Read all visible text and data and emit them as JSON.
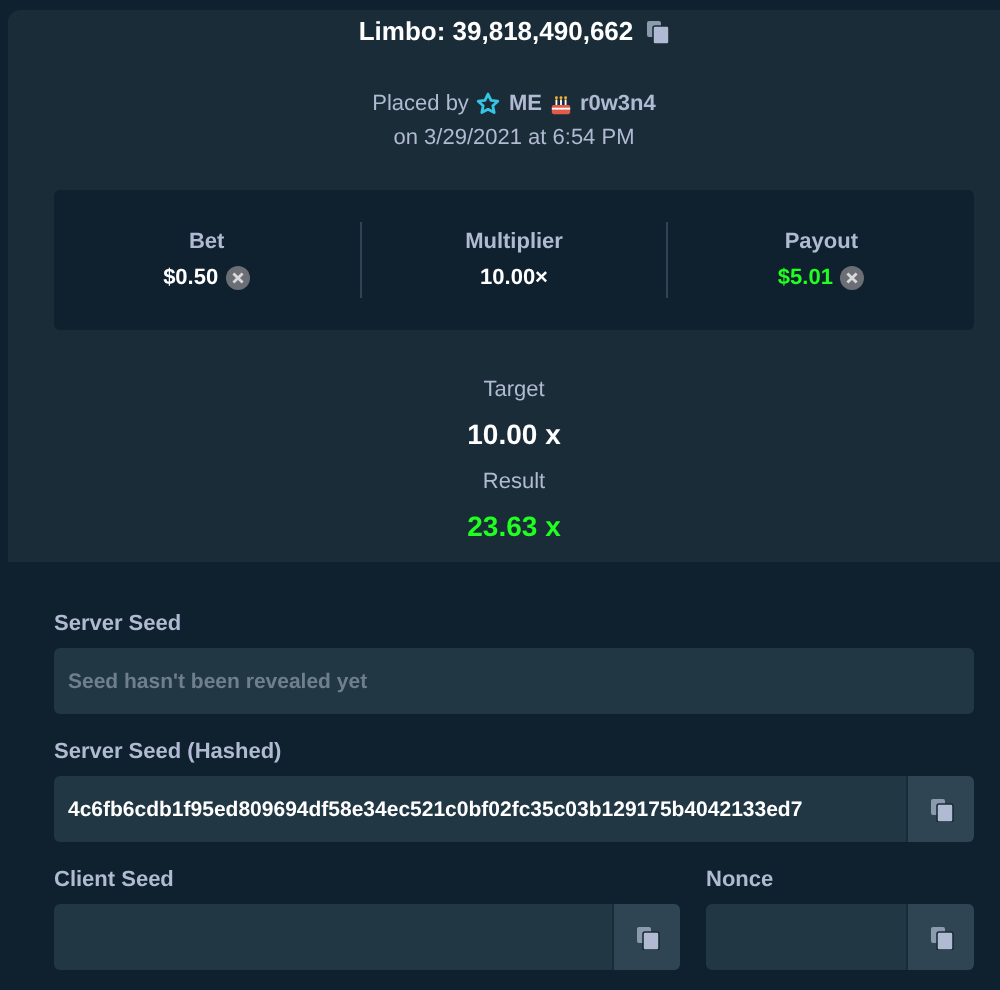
{
  "title": "Limbo: 39,818,490,662",
  "placed_by": {
    "prefix": "Placed by",
    "rank": "ME",
    "username": "r0w3n4",
    "date": "on 3/29/2021 at 6:54 PM"
  },
  "stats": [
    {
      "label": "Bet",
      "value": "$0.50",
      "currency_icon": true,
      "win": false
    },
    {
      "label": "Multiplier",
      "value": "10.00×",
      "win": false
    },
    {
      "label": "Payout",
      "value": "$5.01",
      "currency_icon": true,
      "win": true
    }
  ],
  "target": {
    "label": "Target",
    "value": "10.00 x"
  },
  "result": {
    "label": "Result",
    "value": "23.63 x",
    "win": true
  },
  "seeds": [
    {
      "label": "Server Seed",
      "placeholder": "Seed hasn't been revealed yet"
    },
    {
      "label": "Server Seed (Hashed)",
      "value": "4c6fb6cdb1f95ed809694df58e34ec521c0bf02fc35c03b129175b4042133ed7",
      "copy": true
    }
  ],
  "bottom_fields": [
    {
      "label": "Client Seed",
      "copy": true
    },
    {
      "label": "Nonce",
      "copy": true
    }
  ]
}
